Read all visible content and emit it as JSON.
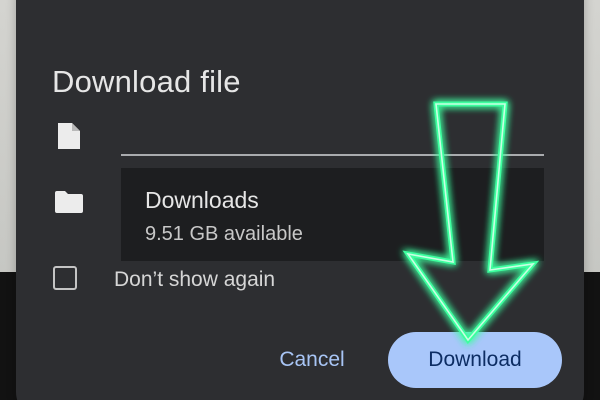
{
  "dialog": {
    "title": "Download file",
    "filename_value": "",
    "location": {
      "name": "Downloads",
      "space": "9.51 GB available"
    },
    "dont_show_again": {
      "label": "Don’t show again",
      "checked": false
    },
    "cancel_label": "Cancel",
    "download_label": "Download"
  },
  "icons": {
    "file": "file-icon",
    "folder": "folder-icon",
    "annotation": "green-neon-arrow-down"
  },
  "colors": {
    "dialog_bg": "#2d2e31",
    "location_bg": "#1d1e20",
    "accent_text": "#a8c5f5",
    "primary_button_bg": "#a9c7fa",
    "primary_button_text": "#0d2d63",
    "arrow_stroke": "#39ff9c"
  }
}
